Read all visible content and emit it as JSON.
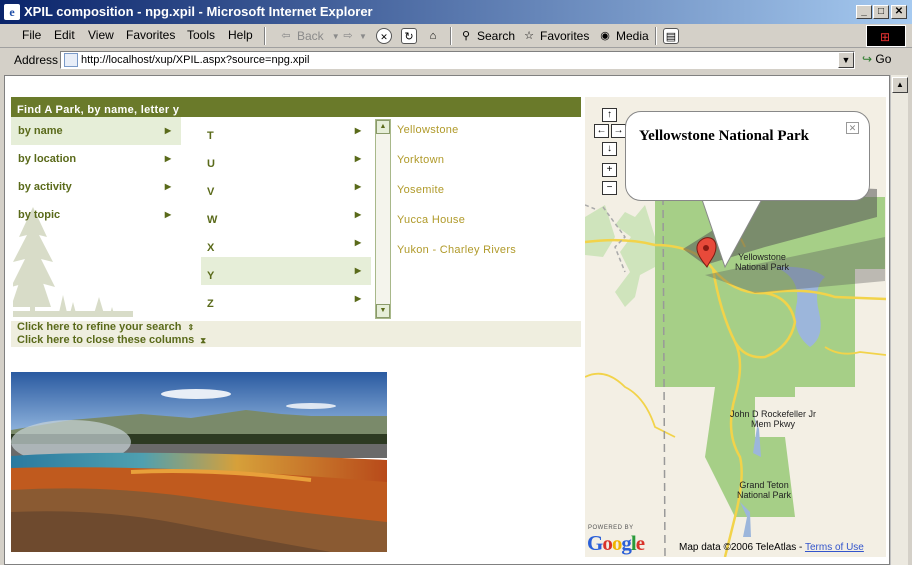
{
  "window": {
    "title": "XPIL composition - npg.xpil - Microsoft Internet Explorer"
  },
  "menu": [
    "File",
    "Edit",
    "View",
    "Favorites",
    "Tools",
    "Help"
  ],
  "toolbar": {
    "back": "Back",
    "search": "Search",
    "favorites": "Favorites",
    "media": "Media"
  },
  "address": {
    "label": "Address",
    "url": "http://localhost/xup/XPIL.aspx?source=npg.xpil",
    "go": "Go"
  },
  "finder": {
    "heading": "Find A Park, by name, letter y",
    "categories": [
      {
        "label": "by name",
        "selected": true
      },
      {
        "label": "by location",
        "selected": false
      },
      {
        "label": "by activity",
        "selected": false
      },
      {
        "label": "by topic",
        "selected": false
      }
    ],
    "letters": [
      {
        "label": "T",
        "selected": false
      },
      {
        "label": "U",
        "selected": false
      },
      {
        "label": "V",
        "selected": false
      },
      {
        "label": "W",
        "selected": false
      },
      {
        "label": "X",
        "selected": false
      },
      {
        "label": "Y",
        "selected": true
      },
      {
        "label": "Z",
        "selected": false
      }
    ],
    "parks": [
      "Yellowstone",
      "Yorktown",
      "Yosemite",
      "Yucca House",
      "Yukon - Charley Rivers"
    ],
    "refine": "Click here to refine your search",
    "close": "Click here to close these columns"
  },
  "map": {
    "bubble_title": "Yellowstone National Park",
    "labels": {
      "yellowstone": [
        "Yellowstone",
        "National Park"
      ],
      "rockefeller": [
        "John D Rockefeller Jr",
        "Mem Pkwy"
      ],
      "teton": [
        "Grand Teton",
        "National Park"
      ]
    },
    "powered_by": "POWERED BY",
    "logo": "Google",
    "credit": "Map data ©2006 TeleAtlas - ",
    "terms": "Terms of Use",
    "colors": {
      "park": "#a6cf87",
      "road": "#f2d34a",
      "water": "#9cb6db"
    }
  }
}
